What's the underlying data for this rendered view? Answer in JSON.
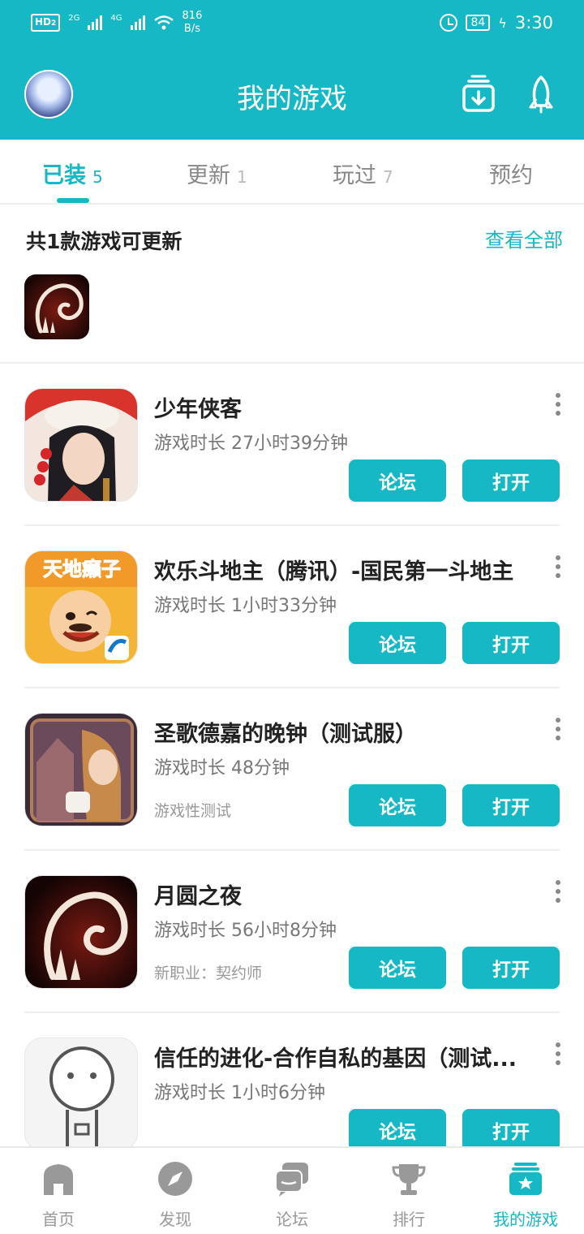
{
  "status_bar": {
    "hd_label": "HD",
    "hd_sub": "2",
    "net1": "2G",
    "net2": "4G",
    "speed_value": "816",
    "speed_unit": "B/s",
    "battery": "84",
    "time": "3:30"
  },
  "header": {
    "title": "我的游戏",
    "icons": [
      "avatar",
      "download-box-icon",
      "rocket-icon"
    ]
  },
  "tabs": [
    {
      "label": "已装",
      "count": "5",
      "active": true
    },
    {
      "label": "更新",
      "count": "1",
      "active": false
    },
    {
      "label": "玩过",
      "count": "7",
      "active": false
    },
    {
      "label": "预约",
      "count": "",
      "active": false
    }
  ],
  "updates": {
    "title": "共1款游戏可更新",
    "view_all": "查看全部"
  },
  "games": [
    {
      "name": "少年侠客",
      "playtime": "游戏时长 27小时39分钟",
      "note": "",
      "forum": "论坛",
      "open": "打开"
    },
    {
      "name": "欢乐斗地主（腾讯）-国民第一斗地主",
      "playtime": "游戏时长 1小时33分钟",
      "note": "",
      "forum": "论坛",
      "open": "打开"
    },
    {
      "name": "圣歌德嘉的晚钟（测试服）",
      "playtime": "游戏时长 48分钟",
      "note": "游戏性测试",
      "forum": "论坛",
      "open": "打开"
    },
    {
      "name": "月圆之夜",
      "playtime": "游戏时长 56小时8分钟",
      "note": "新职业：契约师",
      "forum": "论坛",
      "open": "打开"
    },
    {
      "name": "信任的进化-合作自私的基因（测试...",
      "playtime": "游戏时长 1小时6分钟",
      "note": "",
      "forum": "论坛",
      "open": "打开"
    }
  ],
  "bottom_nav": [
    {
      "label": "首页",
      "icon": "home-icon",
      "active": false
    },
    {
      "label": "发现",
      "icon": "compass-icon",
      "active": false
    },
    {
      "label": "论坛",
      "icon": "forum-icon",
      "active": false
    },
    {
      "label": "排行",
      "icon": "trophy-icon",
      "active": false
    },
    {
      "label": "我的游戏",
      "icon": "my-games-icon",
      "active": true
    }
  ],
  "colors": {
    "accent": "#16b8c6",
    "text_dark": "#222222",
    "text_muted": "#777777"
  }
}
